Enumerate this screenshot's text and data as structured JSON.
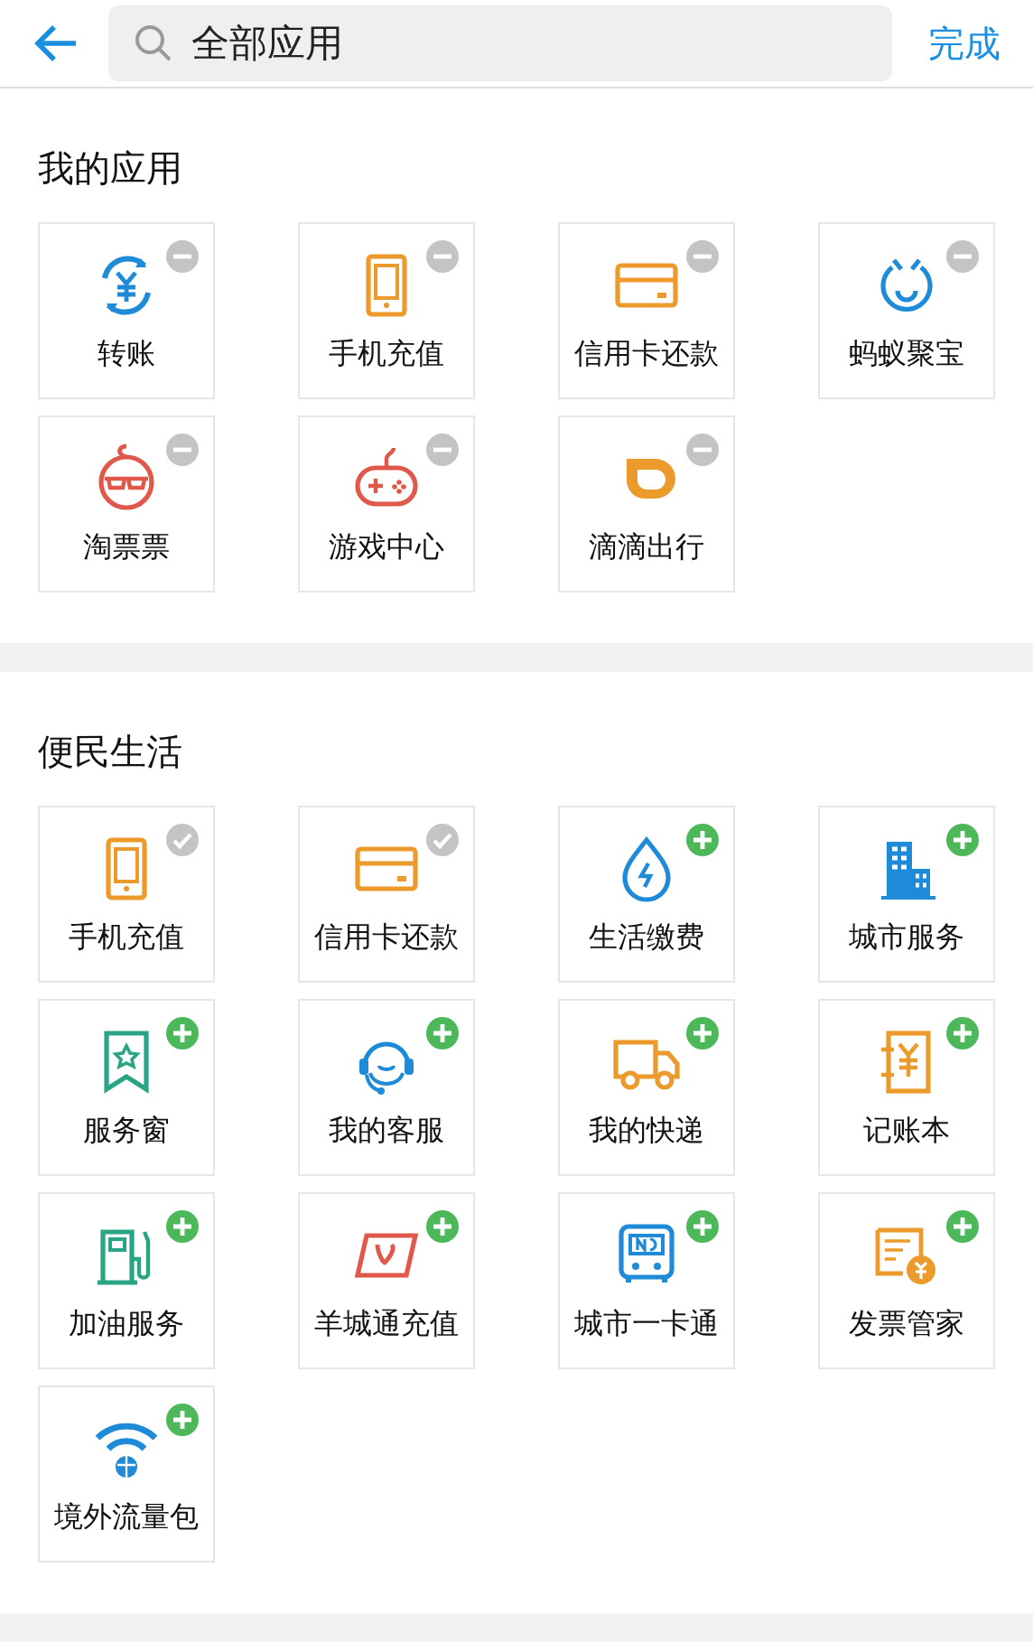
{
  "header": {
    "search": {
      "placeholder": "全部应用"
    },
    "done": "完成"
  },
  "sections": [
    {
      "title": "我的应用",
      "kind": "mine",
      "items": [
        {
          "label": "转账",
          "kind": "transfer"
        },
        {
          "label": "手机充值",
          "kind": "phone"
        },
        {
          "label": "信用卡还款",
          "kind": "card"
        },
        {
          "label": "蚂蚁聚宝",
          "kind": "bao"
        },
        {
          "label": "淘票票",
          "kind": "taopiao"
        },
        {
          "label": "游戏中心",
          "kind": "game"
        },
        {
          "label": "滴滴出行",
          "kind": "didi"
        }
      ]
    },
    {
      "title": "便民生活",
      "kind": "catalog",
      "items": [
        {
          "label": "手机充值",
          "kind": "phone",
          "added": true
        },
        {
          "label": "信用卡还款",
          "kind": "card",
          "added": true
        },
        {
          "label": "生活缴费",
          "kind": "water",
          "added": false
        },
        {
          "label": "城市服务",
          "kind": "building",
          "added": false
        },
        {
          "label": "服务窗",
          "kind": "bookmark",
          "added": false
        },
        {
          "label": "我的客服",
          "kind": "service",
          "added": false
        },
        {
          "label": "我的快递",
          "kind": "truck",
          "added": false
        },
        {
          "label": "记账本",
          "kind": "ledger",
          "added": false
        },
        {
          "label": "加油服务",
          "kind": "fuel",
          "added": false
        },
        {
          "label": "羊城通充值",
          "kind": "vcard",
          "added": false
        },
        {
          "label": "城市一卡通",
          "kind": "buscard",
          "added": false
        },
        {
          "label": "发票管家",
          "kind": "invoice",
          "added": false
        },
        {
          "label": "境外流量包",
          "kind": "wifi",
          "added": false
        }
      ]
    }
  ]
}
